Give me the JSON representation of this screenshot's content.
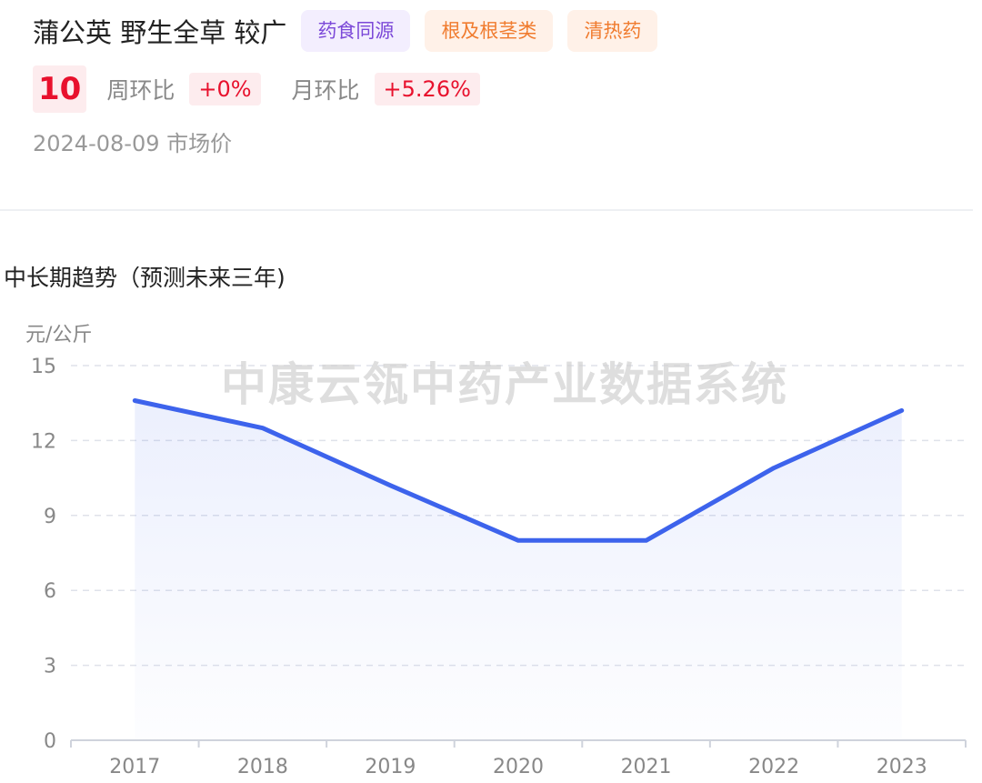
{
  "header": {
    "title": "蒲公英 野生全草 较广",
    "tags": [
      {
        "label": "药食同源",
        "bg": "#f3eefe",
        "color": "#7b48d8"
      },
      {
        "label": "根及根茎类",
        "bg": "#fff1e8",
        "color": "#f07b2e"
      },
      {
        "label": "清热药",
        "bg": "#fff1e8",
        "color": "#f07b2e"
      }
    ],
    "price": "10",
    "week_label": "周环比",
    "week_change": "+0%",
    "month_label": "月环比",
    "month_change": "+5.26%",
    "date": "2024-08-09 市场价"
  },
  "section_title": "中长期趋势（预测未来三年)",
  "watermark": "中康云瓴中药产业数据系统",
  "colors": {
    "line": "#3d63ec",
    "up": "#e8112d",
    "grid": "#dfe2ea"
  },
  "chart_data": {
    "type": "area",
    "x": [
      "2017",
      "2018",
      "2019",
      "2020",
      "2021",
      "2022",
      "2023"
    ],
    "values": [
      13.6,
      12.5,
      10.2,
      8.0,
      8.0,
      10.9,
      13.2
    ],
    "ylabel": "元/公斤",
    "yticks": [
      0,
      3,
      6,
      9,
      12,
      15
    ],
    "ylim": [
      0,
      15
    ],
    "grid": true
  }
}
